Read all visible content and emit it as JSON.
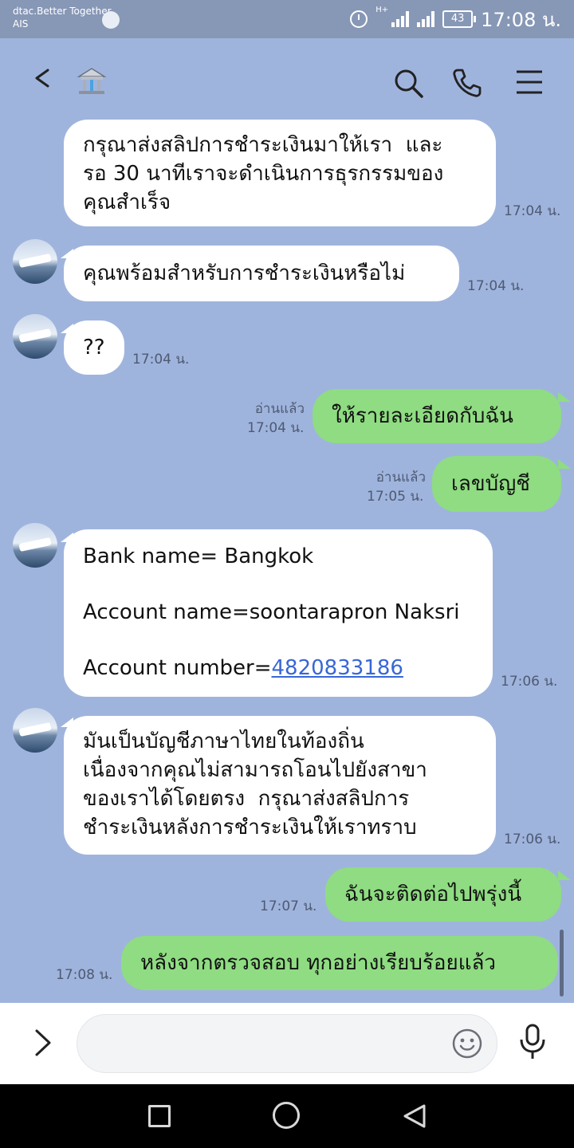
{
  "status_bar": {
    "carrier_line1": "dtac.Better Together",
    "carrier_line2": "AIS",
    "network": "H+",
    "battery": "43",
    "time": "17:08 น."
  },
  "header": {
    "chat_icon": "bank-icon"
  },
  "messages": [
    {
      "dir": "in",
      "text": "กรุณาส่งสลิปการชำระเงินมาให้เรา  และ\nรอ 30 นาทีเราจะดำเนินการธุรกรรมของ\nคุณสำเร็จ",
      "time": "17:04 น."
    },
    {
      "dir": "in",
      "text": "คุณพร้อมสำหรับการชำระเงินหรือไม่",
      "time": "17:04 น."
    },
    {
      "dir": "in",
      "text": "??",
      "time": "17:04 น."
    },
    {
      "dir": "out",
      "text": "ให้รายละเอียดกับฉัน",
      "read": "อ่านแล้ว",
      "time": "17:04 น."
    },
    {
      "dir": "out",
      "text": "เลขบัญชี",
      "read": "อ่านแล้ว",
      "time": "17:05 น."
    },
    {
      "dir": "in",
      "line1": "Bank name= Bangkok",
      "line2": "Account name=soontarapron Naksri",
      "line3_prefix": "Account number=",
      "account_number": "4820833186",
      "time": "17:06 น."
    },
    {
      "dir": "in",
      "text": "มันเป็นบัญชีภาษาไทยในท้องถิ่น\nเนื่องจากคุณไม่สามารถโอนไปยังสาขา\nของเราได้โดยตรง  กรุณาส่งสลิปการ\nชำระเงินหลังการชำระเงินให้เราทราบ",
      "time": "17:06 น."
    },
    {
      "dir": "out",
      "text": "ฉันจะติดต่อไปพรุ่งนี้",
      "time": "17:07 น."
    },
    {
      "dir": "out",
      "text": "หลังจากตรวจสอบ ทุกอย่างเรียบร้อยแล้ว",
      "time": "17:08 น."
    }
  ],
  "input": {
    "value": "",
    "placeholder": ""
  },
  "colors": {
    "chat_background": "#9fb4dd",
    "incoming_bubble": "#ffffff",
    "outgoing_bubble": "#8fdc82",
    "link": "#3867d6"
  }
}
